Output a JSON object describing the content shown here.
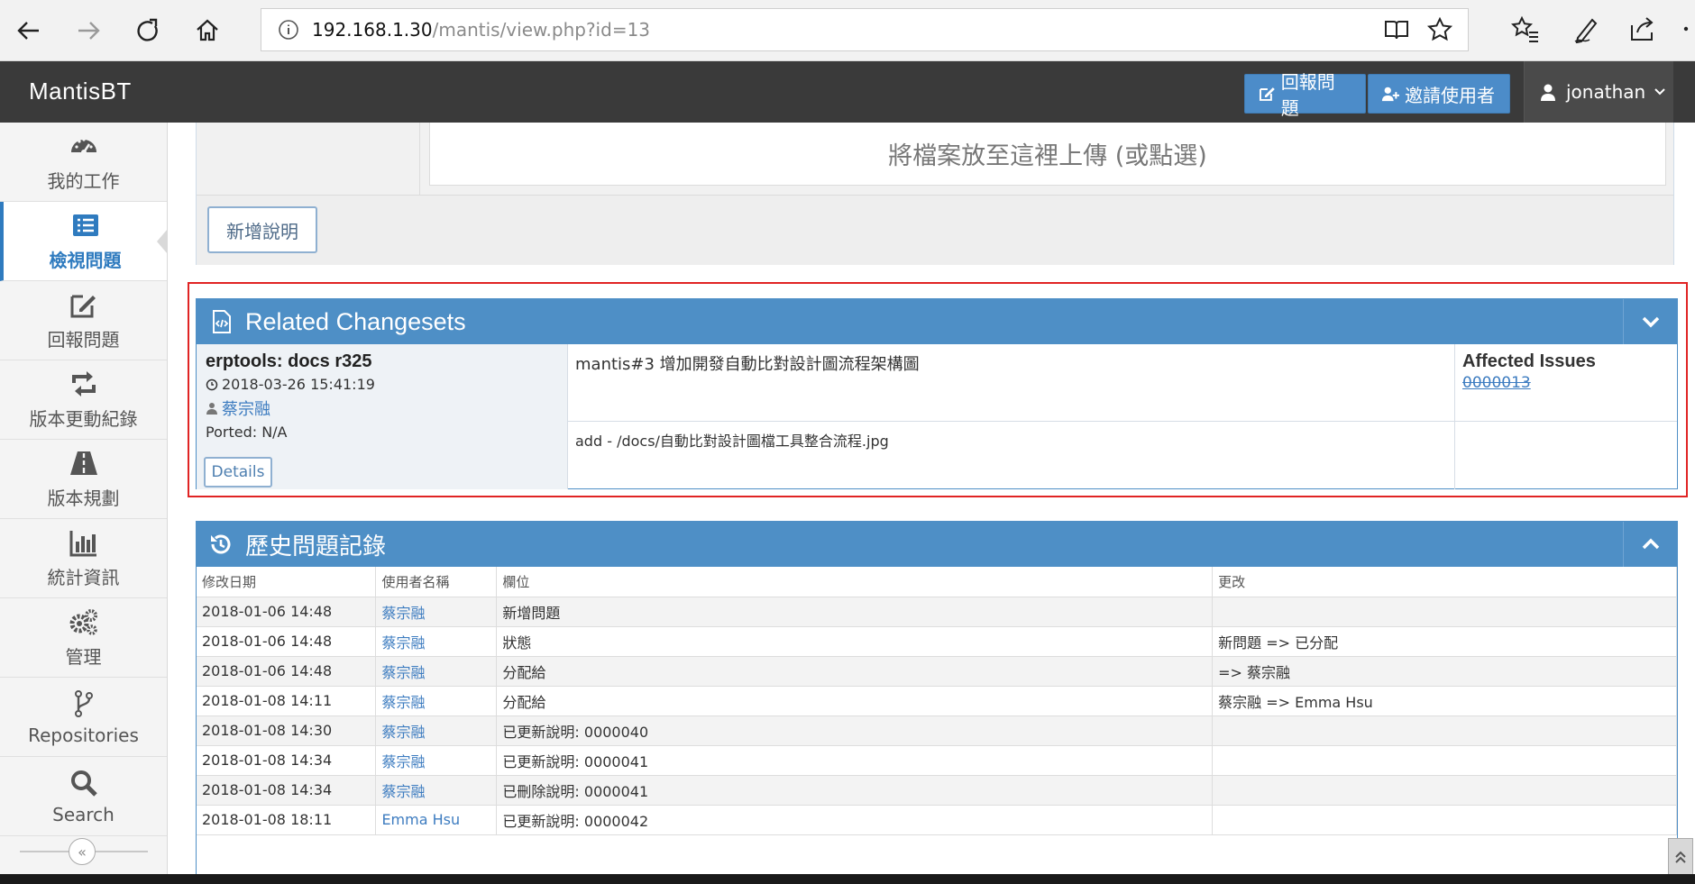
{
  "browser": {
    "url_host": "192.168.1.30",
    "url_path": "/mantis/view.php?id=13"
  },
  "navbar": {
    "brand": "MantisBT",
    "report_button": "回報問題",
    "invite_button": "邀請使用者",
    "user": "jonathan"
  },
  "sidebar": {
    "items": [
      {
        "label": "我的工作",
        "icon": "dashboard-icon"
      },
      {
        "label": "檢視問題",
        "icon": "list-icon"
      },
      {
        "label": "回報問題",
        "icon": "edit-icon"
      },
      {
        "label": "版本更動紀錄",
        "icon": "retweet-icon"
      },
      {
        "label": "版本規劃",
        "icon": "road-icon"
      },
      {
        "label": "統計資訊",
        "icon": "bar-chart-icon"
      },
      {
        "label": "管理",
        "icon": "gears-icon"
      },
      {
        "label": "Repositories",
        "icon": "branch-icon"
      },
      {
        "label": "Search",
        "icon": "search-icon"
      }
    ],
    "toggle": "«"
  },
  "upload": {
    "drop_text": "將檔案放至這裡上傳 (或點選)",
    "add_note_button": "新增說明"
  },
  "related_changesets": {
    "title": "Related Changesets",
    "changeset_title": "erptools: docs r325",
    "timestamp": "2018-03-26 15:41:19",
    "author": "蔡宗融",
    "ported": "Ported: N/A",
    "details_button": "Details",
    "message": "mantis#3 增加開發自動比對設計圖流程架構圖",
    "file_change": "add - /docs/自動比對設計圖檔工具整合流程.jpg",
    "affected_label": "Affected Issues",
    "affected_issue": "0000013"
  },
  "history": {
    "title": "歷史問題記錄",
    "columns": [
      "修改日期",
      "使用者名稱",
      "欄位",
      "更改"
    ],
    "rows": [
      [
        "2018-01-06 14:48",
        "蔡宗融",
        "新增問題",
        ""
      ],
      [
        "2018-01-06 14:48",
        "蔡宗融",
        "狀態",
        "新問題 => 已分配"
      ],
      [
        "2018-01-06 14:48",
        "蔡宗融",
        "分配給",
        "=> 蔡宗融"
      ],
      [
        "2018-01-08 14:11",
        "蔡宗融",
        "分配給",
        "蔡宗融 => Emma Hsu"
      ],
      [
        "2018-01-08 14:30",
        "蔡宗融",
        "已更新說明: 0000040",
        ""
      ],
      [
        "2018-01-08 14:34",
        "蔡宗融",
        "已更新說明: 0000041",
        ""
      ],
      [
        "2018-01-08 14:34",
        "蔡宗融",
        "已刪除說明: 0000041",
        ""
      ],
      [
        "2018-01-08 18:11",
        "Emma Hsu",
        "已更新說明: 0000042",
        ""
      ]
    ]
  },
  "colors": {
    "panel_header": "#4e8fc6",
    "navbar": "#3a3a3a",
    "highlight": "#e02424",
    "link": "#3d7cc0"
  }
}
